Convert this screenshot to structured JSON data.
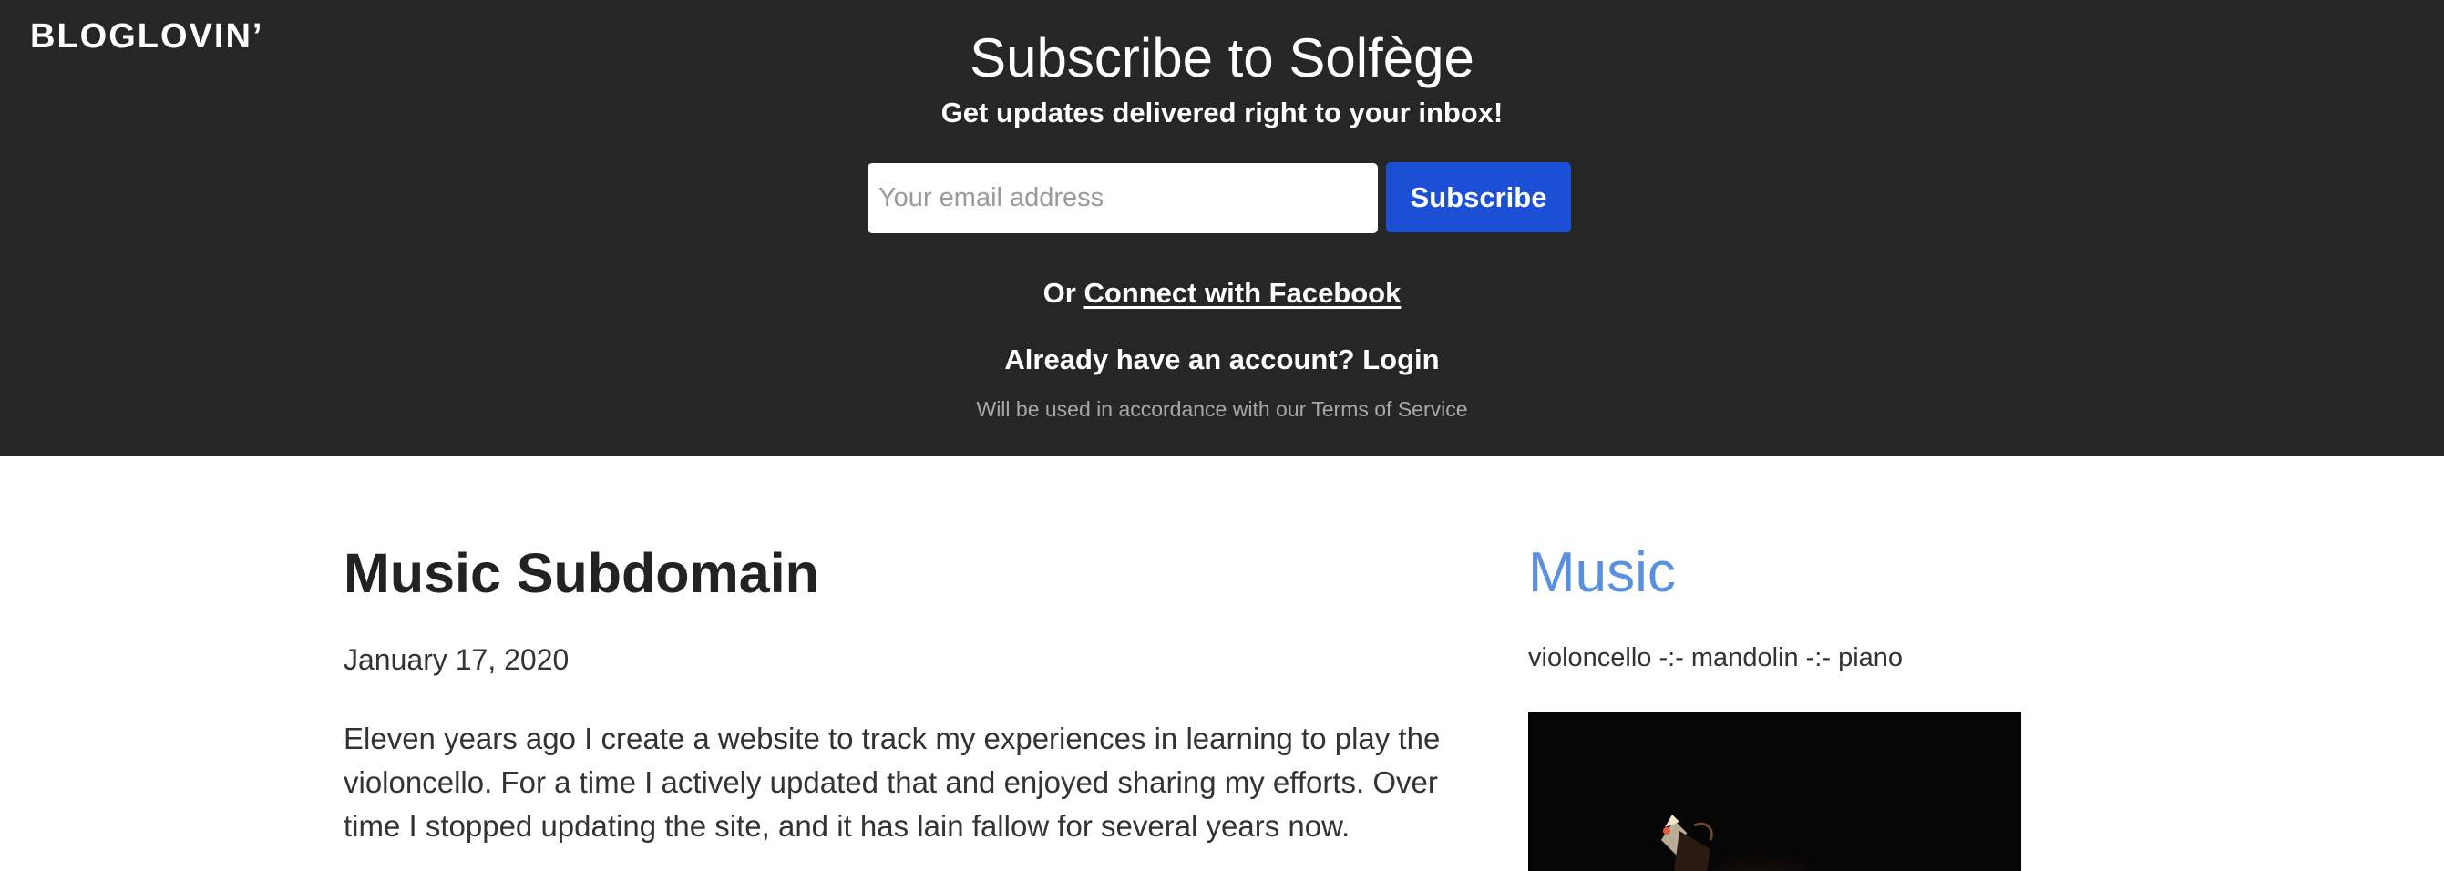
{
  "banner": {
    "logo": "BLOGLOVIN’",
    "title": "Subscribe to Solfège",
    "subtitle": "Get updates delivered right to your inbox!",
    "email_placeholder": "Your email address",
    "email_value": "",
    "subscribe_label": "Subscribe",
    "or_label": "Or ",
    "facebook_link": "Connect with Facebook",
    "account_prompt": "Already have an account? ",
    "login_label": "Login",
    "terms": "Will be used in accordance with our Terms of Service",
    "colors": {
      "background": "#262626",
      "subscribe_button": "#1a4fd6"
    }
  },
  "article": {
    "title": "Music Subdomain",
    "date": "January 17, 2020",
    "body": "Eleven years ago I create a website to track my experiences in learning to play the violoncello. For a time I actively updated that and enjoyed sharing my efforts. Over time I stopped updating the site, and it has lain fallow for several years now."
  },
  "sidebar": {
    "title": "Music",
    "tagline": "violoncello -:- mandolin -:- piano",
    "image_icon": "instrument-photo",
    "colors": {
      "title": "#5b8fe0"
    }
  }
}
